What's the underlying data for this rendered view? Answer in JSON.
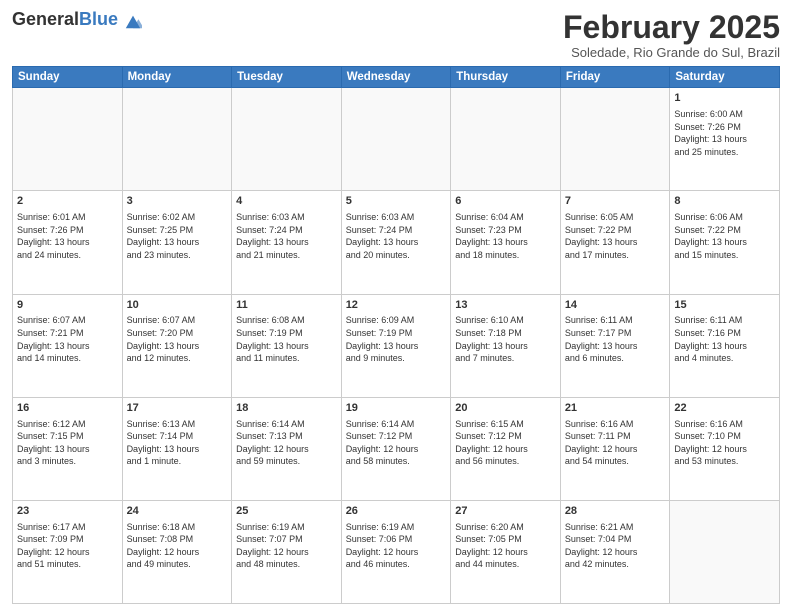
{
  "header": {
    "logo_general": "General",
    "logo_blue": "Blue",
    "month_title": "February 2025",
    "location": "Soledade, Rio Grande do Sul, Brazil"
  },
  "weekdays": [
    "Sunday",
    "Monday",
    "Tuesday",
    "Wednesday",
    "Thursday",
    "Friday",
    "Saturday"
  ],
  "weeks": [
    [
      {
        "day": "",
        "info": ""
      },
      {
        "day": "",
        "info": ""
      },
      {
        "day": "",
        "info": ""
      },
      {
        "day": "",
        "info": ""
      },
      {
        "day": "",
        "info": ""
      },
      {
        "day": "",
        "info": ""
      },
      {
        "day": "1",
        "info": "Sunrise: 6:00 AM\nSunset: 7:26 PM\nDaylight: 13 hours\nand 25 minutes."
      }
    ],
    [
      {
        "day": "2",
        "info": "Sunrise: 6:01 AM\nSunset: 7:26 PM\nDaylight: 13 hours\nand 24 minutes."
      },
      {
        "day": "3",
        "info": "Sunrise: 6:02 AM\nSunset: 7:25 PM\nDaylight: 13 hours\nand 23 minutes."
      },
      {
        "day": "4",
        "info": "Sunrise: 6:03 AM\nSunset: 7:24 PM\nDaylight: 13 hours\nand 21 minutes."
      },
      {
        "day": "5",
        "info": "Sunrise: 6:03 AM\nSunset: 7:24 PM\nDaylight: 13 hours\nand 20 minutes."
      },
      {
        "day": "6",
        "info": "Sunrise: 6:04 AM\nSunset: 7:23 PM\nDaylight: 13 hours\nand 18 minutes."
      },
      {
        "day": "7",
        "info": "Sunrise: 6:05 AM\nSunset: 7:22 PM\nDaylight: 13 hours\nand 17 minutes."
      },
      {
        "day": "8",
        "info": "Sunrise: 6:06 AM\nSunset: 7:22 PM\nDaylight: 13 hours\nand 15 minutes."
      }
    ],
    [
      {
        "day": "9",
        "info": "Sunrise: 6:07 AM\nSunset: 7:21 PM\nDaylight: 13 hours\nand 14 minutes."
      },
      {
        "day": "10",
        "info": "Sunrise: 6:07 AM\nSunset: 7:20 PM\nDaylight: 13 hours\nand 12 minutes."
      },
      {
        "day": "11",
        "info": "Sunrise: 6:08 AM\nSunset: 7:19 PM\nDaylight: 13 hours\nand 11 minutes."
      },
      {
        "day": "12",
        "info": "Sunrise: 6:09 AM\nSunset: 7:19 PM\nDaylight: 13 hours\nand 9 minutes."
      },
      {
        "day": "13",
        "info": "Sunrise: 6:10 AM\nSunset: 7:18 PM\nDaylight: 13 hours\nand 7 minutes."
      },
      {
        "day": "14",
        "info": "Sunrise: 6:11 AM\nSunset: 7:17 PM\nDaylight: 13 hours\nand 6 minutes."
      },
      {
        "day": "15",
        "info": "Sunrise: 6:11 AM\nSunset: 7:16 PM\nDaylight: 13 hours\nand 4 minutes."
      }
    ],
    [
      {
        "day": "16",
        "info": "Sunrise: 6:12 AM\nSunset: 7:15 PM\nDaylight: 13 hours\nand 3 minutes."
      },
      {
        "day": "17",
        "info": "Sunrise: 6:13 AM\nSunset: 7:14 PM\nDaylight: 13 hours\nand 1 minute."
      },
      {
        "day": "18",
        "info": "Sunrise: 6:14 AM\nSunset: 7:13 PM\nDaylight: 12 hours\nand 59 minutes."
      },
      {
        "day": "19",
        "info": "Sunrise: 6:14 AM\nSunset: 7:12 PM\nDaylight: 12 hours\nand 58 minutes."
      },
      {
        "day": "20",
        "info": "Sunrise: 6:15 AM\nSunset: 7:12 PM\nDaylight: 12 hours\nand 56 minutes."
      },
      {
        "day": "21",
        "info": "Sunrise: 6:16 AM\nSunset: 7:11 PM\nDaylight: 12 hours\nand 54 minutes."
      },
      {
        "day": "22",
        "info": "Sunrise: 6:16 AM\nSunset: 7:10 PM\nDaylight: 12 hours\nand 53 minutes."
      }
    ],
    [
      {
        "day": "23",
        "info": "Sunrise: 6:17 AM\nSunset: 7:09 PM\nDaylight: 12 hours\nand 51 minutes."
      },
      {
        "day": "24",
        "info": "Sunrise: 6:18 AM\nSunset: 7:08 PM\nDaylight: 12 hours\nand 49 minutes."
      },
      {
        "day": "25",
        "info": "Sunrise: 6:19 AM\nSunset: 7:07 PM\nDaylight: 12 hours\nand 48 minutes."
      },
      {
        "day": "26",
        "info": "Sunrise: 6:19 AM\nSunset: 7:06 PM\nDaylight: 12 hours\nand 46 minutes."
      },
      {
        "day": "27",
        "info": "Sunrise: 6:20 AM\nSunset: 7:05 PM\nDaylight: 12 hours\nand 44 minutes."
      },
      {
        "day": "28",
        "info": "Sunrise: 6:21 AM\nSunset: 7:04 PM\nDaylight: 12 hours\nand 42 minutes."
      },
      {
        "day": "",
        "info": ""
      }
    ]
  ]
}
